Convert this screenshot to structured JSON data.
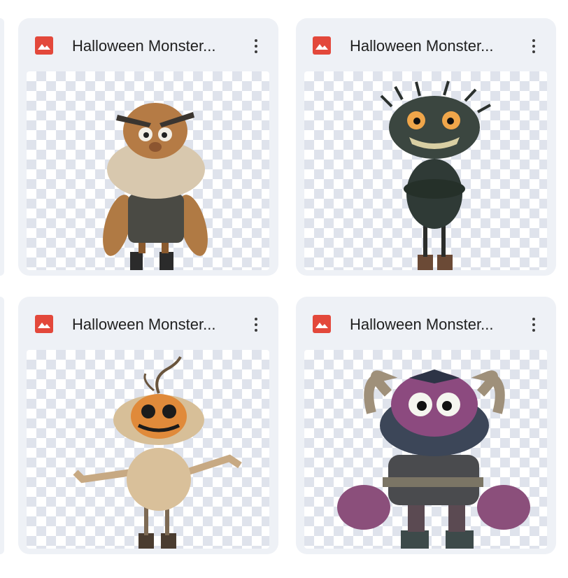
{
  "files": [
    {
      "name": "Halloween Monster...",
      "type_icon": "image-icon",
      "accent": "#e3483b",
      "monster": "bearded-brown-monster"
    },
    {
      "name": "Halloween Monster...",
      "type_icon": "image-icon",
      "accent": "#e3483b",
      "monster": "dark-furry-monster"
    },
    {
      "name": "Halloween Monster...",
      "type_icon": "image-icon",
      "accent": "#e3483b",
      "monster": "pumpkin-head-monster"
    },
    {
      "name": "Halloween Monster...",
      "type_icon": "image-icon",
      "accent": "#e3483b",
      "monster": "purple-horned-monster"
    }
  ]
}
